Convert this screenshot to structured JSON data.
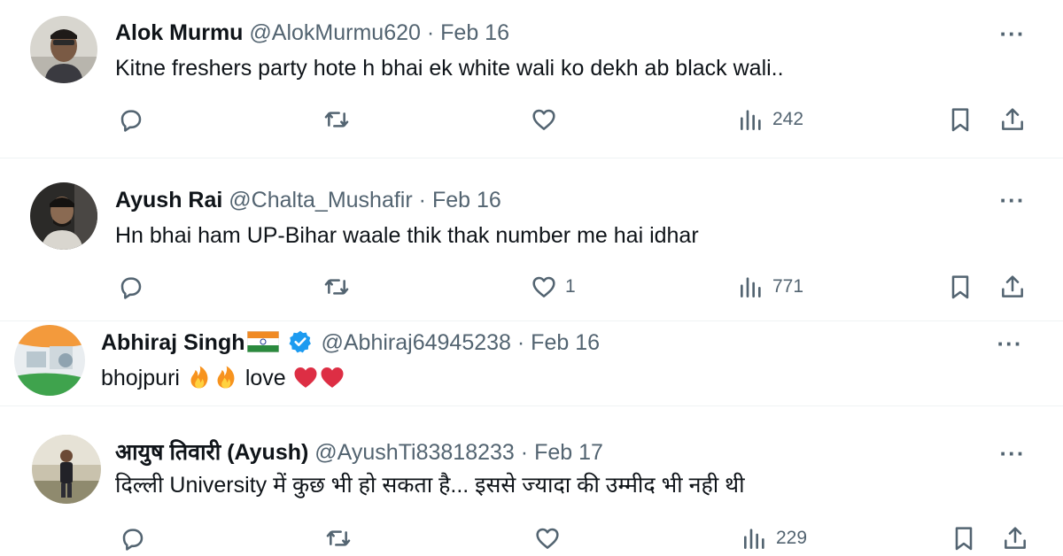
{
  "replies": [
    {
      "name": "Alok Murmu",
      "handle": "@AlokMurmu620",
      "date": "Feb 16",
      "text": "Kitne freshers party hote h bhai  ek white wali ko dekh ab black wali..",
      "likes": "",
      "views": "242"
    },
    {
      "name": "Ayush Rai",
      "handle": "@Chalta_Mushafir",
      "date": "Feb 16",
      "text": "Hn bhai ham UP-Bihar waale thik thak number me hai idhar",
      "likes": "1",
      "views": "771"
    },
    {
      "name": "Abhiraj Singh",
      "handle": "@Abhiraj64945238",
      "date": "Feb 16",
      "text_before": "bhojpuri ",
      "text_middle": " love ",
      "verified": true,
      "flag": "india-flag",
      "emojis": [
        "fire",
        "fire",
        "red-heart",
        "red-heart"
      ]
    },
    {
      "name": "आयुष तिवारी (Ayush)",
      "handle": "@AyushTi83818233",
      "date": "Feb 17",
      "text": "दिल्ली University में कुछ भी हो सकता है... इससे ज्यादा की उम्मीद भी नही थी",
      "likes": "",
      "views": "229"
    }
  ],
  "ui": {
    "separator": "·",
    "more_label": "···"
  },
  "icons": {
    "reply": "speech-bubble-icon",
    "retweet": "retweet-arrows-icon",
    "like": "heart-outline-icon",
    "views": "bar-chart-icon",
    "bookmark": "bookmark-icon",
    "share": "share-upload-icon"
  },
  "colors": {
    "text_primary": "#0f1419",
    "text_secondary": "#536471",
    "verified": "#1d9bf0",
    "divider": "#eff3f4"
  }
}
